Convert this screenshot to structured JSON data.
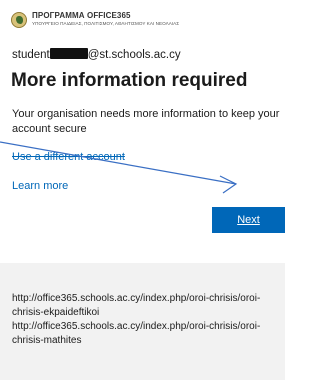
{
  "header": {
    "logo_title": "ΠΡΟΓΡΑΜΜΑ OFFICE365",
    "logo_subtitle": "ΥΠΟΥΡΓΕΙΟ ΠΑΙΔΕΙΑΣ, ΠΟΛΙΤΙΣΜΟΥ, ΑΘΛΗΤΙΣΜΟΥ ΚΑΙ ΝΕΟΛΑΙΑΣ"
  },
  "account": {
    "prefix": "student",
    "domain": "@st.schools.ac.cy"
  },
  "main": {
    "title": "More information required",
    "description": "Your organisation needs more information to keep your account secure",
    "use_different_account": "Use a different account",
    "learn_more": "Learn more",
    "next_label": "Next"
  },
  "footer": {
    "links": [
      "http://office365.schools.ac.cy/index.php/oroi-chrisis/oroi-chrisis-ekpaideftikoi",
      "http://office365.schools.ac.cy/index.php/oroi-chrisis/oroi-chrisis-mathites"
    ]
  },
  "colors": {
    "accent": "#0067b8",
    "footer_bg": "#f2f2f2"
  }
}
